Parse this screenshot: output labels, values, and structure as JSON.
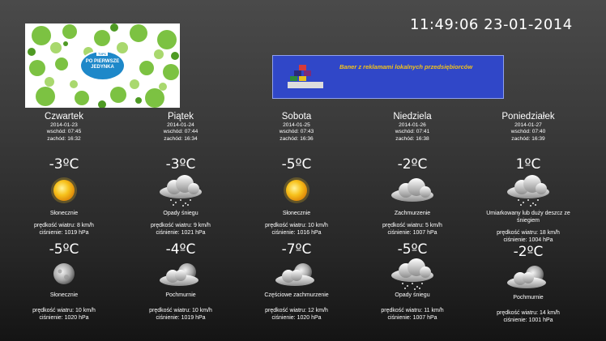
{
  "clock": {
    "time": "11:49:06",
    "date": "23-01-2014"
  },
  "tv": {
    "badge_line1": "PO PIERWSZE",
    "badge_line2": "JEDYNKA",
    "logo": "TVP1"
  },
  "banner": {
    "text": "Baner z reklamami lokalnych przedsiębiorców",
    "brand_top": "MK",
    "brand_bottom": "MK SYSTEM",
    "colors": {
      "background": "#3047c8",
      "text": "#f2c21b"
    }
  },
  "days": [
    {
      "name": "Czwartek",
      "date": "2014-01-23",
      "sunrise": "wschód: 07:45",
      "sunset": "zachód: 16:32",
      "day": {
        "temp": "-3ºC",
        "icon": "sun-icon",
        "condition": "Słonecznie",
        "wind": "prędkość wiatru: 8 km/h",
        "pressure": "ciśnienie: 1019 hPa"
      },
      "night": {
        "temp": "-5ºC",
        "icon": "moon-icon",
        "condition": "Słonecznie",
        "wind": "prędkość wiatru: 10 km/h",
        "pressure": "ciśnienie: 1020 hPa"
      }
    },
    {
      "name": "Piątek",
      "date": "2014-01-24",
      "sunrise": "wschód: 07:44",
      "sunset": "zachód: 16:34",
      "day": {
        "temp": "-3ºC",
        "icon": "snow-cloud-icon",
        "condition": "Opady śniegu",
        "wind": "prędkość wiatru: 9 km/h",
        "pressure": "ciśnienie: 1021 hPa"
      },
      "night": {
        "temp": "-4ºC",
        "icon": "moon-cloud-icon",
        "condition": "Pochmurnie",
        "wind": "prędkość wiatru: 10 km/h",
        "pressure": "ciśnienie: 1019 hPa"
      }
    },
    {
      "name": "Sobota",
      "date": "2014-01-25",
      "sunrise": "wschód: 07:43",
      "sunset": "zachód: 16:36",
      "day": {
        "temp": "-5ºC",
        "icon": "sun-icon",
        "condition": "Słonecznie",
        "wind": "prędkość wiatru: 10 km/h",
        "pressure": "ciśnienie: 1016 hPa"
      },
      "night": {
        "temp": "-7ºC",
        "icon": "moon-cloud-icon",
        "condition": "Częściowe zachmurzenie",
        "wind": "prędkość wiatru: 12 km/h",
        "pressure": "ciśnienie: 1020 hPa"
      }
    },
    {
      "name": "Niedziela",
      "date": "2014-01-26",
      "sunrise": "wschód: 07:41",
      "sunset": "zachód: 16:38",
      "day": {
        "temp": "-2ºC",
        "icon": "cloud-icon",
        "condition": "Zachmurzenie",
        "wind": "prędkość wiatru: 5 km/h",
        "pressure": "ciśnienie: 1007 hPa"
      },
      "night": {
        "temp": "-5ºC",
        "icon": "snow-cloud-icon",
        "condition": "Opady śniegu",
        "wind": "prędkość wiatru: 11 km/h",
        "pressure": "ciśnienie: 1007 hPa"
      }
    },
    {
      "name": "Poniedziałek",
      "date": "2014-01-27",
      "sunrise": "wschód: 07:40",
      "sunset": "zachód: 16:39",
      "day": {
        "temp": "1ºC",
        "icon": "snow-cloud-icon",
        "condition": "Umiarkowany lub duży deszcz ze śniegiem",
        "wind": "prędkość wiatru: 18 km/h",
        "pressure": "ciśnienie: 1004 hPa"
      },
      "night": {
        "temp": "-2ºC",
        "icon": "moon-cloud-icon",
        "condition": "Pochmurnie",
        "wind": "prędkość wiatru: 14 km/h",
        "pressure": "ciśnienie: 1001 hPa"
      }
    }
  ]
}
